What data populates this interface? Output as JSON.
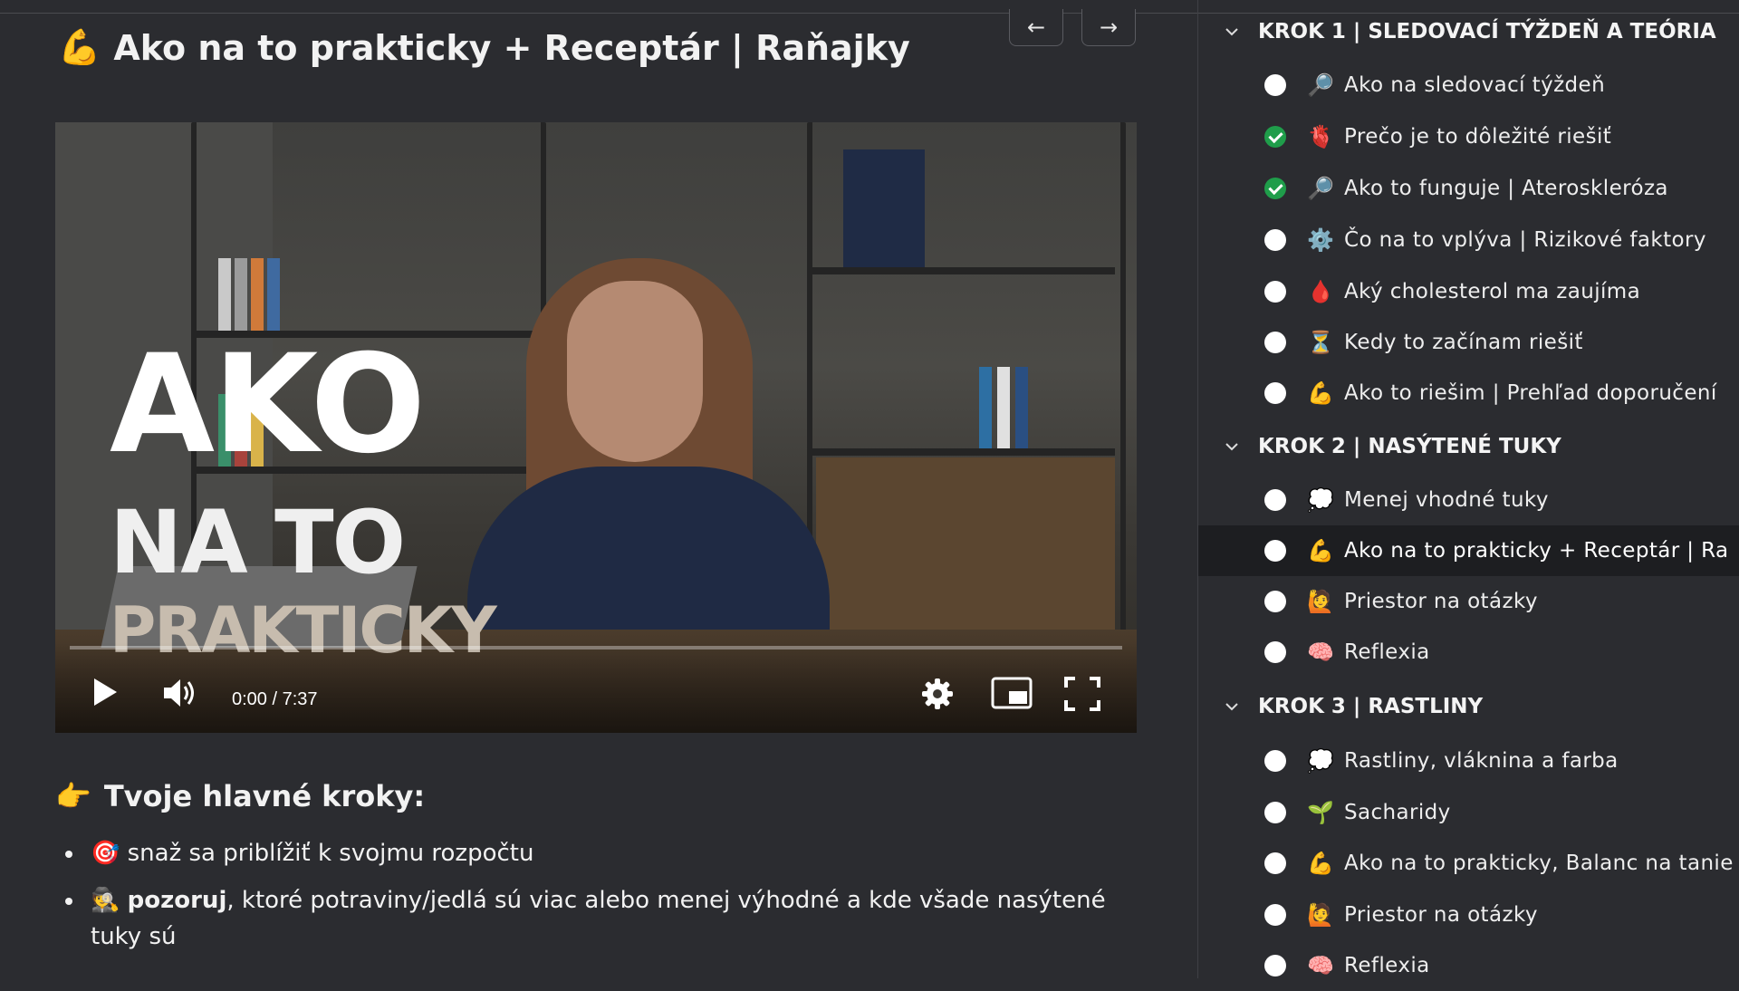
{
  "lesson": {
    "title_emoji": "💪",
    "title": "Ako na to prakticky + Receptár | Raňajky",
    "prev_label": "←",
    "next_label": "→"
  },
  "video": {
    "overlay_line_1": "AKO",
    "overlay_line_2": "NA TO",
    "overlay_line_3": "PRAKTICKY",
    "time": "0:00 / 7:37",
    "progress_fraction": 0.0,
    "icons": [
      "play-icon",
      "volume-icon",
      "settings-icon",
      "miniplayer-icon",
      "fullscreen-icon"
    ]
  },
  "steps_section": {
    "heading_emoji": "👉",
    "heading": "Tvoje hlavné kroky:",
    "items": [
      {
        "emoji": "🎯",
        "bold": "",
        "text": "snaž sa priblížiť k svojmu rozpočtu"
      },
      {
        "emoji": "🕵️",
        "bold": "pozoruj",
        "text": ", ktoré potraviny/jedlá sú viac alebo menej výhodné a kde všade nasýtené tuky sú"
      }
    ]
  },
  "sidebar": {
    "modules": [
      {
        "title": "KROK 1 | SLEDOVACÍ TÝŽDEŇ A TEÓRIA",
        "lessons": [
          {
            "emoji": "🔎",
            "label": "Ako na sledovací týždeň",
            "done": false
          },
          {
            "emoji": "🫀",
            "label": "Prečo je to dôležité riešiť",
            "done": true
          },
          {
            "emoji": "🔎",
            "label": "Ako to funguje | Ateroskleróza",
            "done": true
          },
          {
            "emoji": "⚙️",
            "label": "Čo na to vplýva | Rizikové faktory",
            "done": false
          },
          {
            "emoji": "🩸",
            "label": "Aký cholesterol ma zaujíma",
            "done": false
          },
          {
            "emoji": "⏳",
            "label": "Kedy to začínam riešiť",
            "done": false
          },
          {
            "emoji": "💪",
            "label": "Ako to riešim | Prehľad doporučení",
            "done": false
          }
        ]
      },
      {
        "title": "KROK 2 | NASÝTENÉ TUKY",
        "lessons": [
          {
            "emoji": "💭",
            "label": "Menej vhodné tuky",
            "done": false
          },
          {
            "emoji": "💪",
            "label": "Ako na to prakticky + Receptár | Ra",
            "done": false,
            "active": true
          },
          {
            "emoji": "🙋",
            "label": "Priestor na otázky",
            "done": false
          },
          {
            "emoji": "🧠",
            "label": "Reflexia",
            "done": false
          }
        ]
      },
      {
        "title": "KROK 3 | RASTLINY",
        "lessons": [
          {
            "emoji": "💭",
            "label": "Rastliny, vláknina a farba",
            "done": false
          },
          {
            "emoji": "🌱",
            "label": "Sacharidy",
            "done": false
          },
          {
            "emoji": "💪",
            "label": "Ako na to prakticky, Balanc na tanie",
            "done": false
          },
          {
            "emoji": "🙋",
            "label": "Priestor na otázky",
            "done": false
          },
          {
            "emoji": "🧠",
            "label": "Reflexia",
            "done": false
          }
        ]
      }
    ]
  }
}
